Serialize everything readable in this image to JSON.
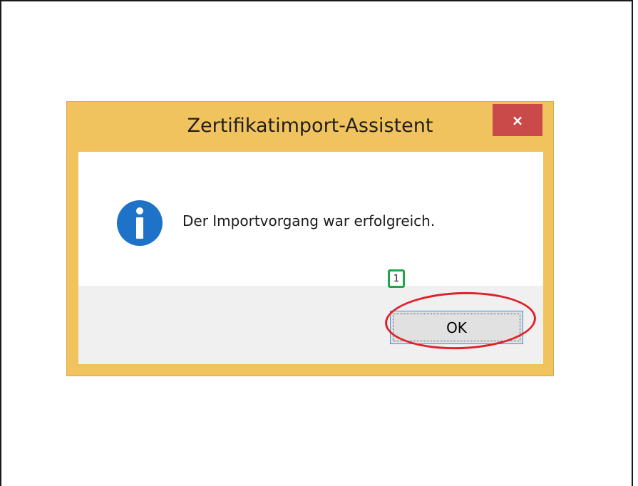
{
  "dialog": {
    "title": "Zertifikatimport-Assistent",
    "close_glyph": "×",
    "message": "Der Importvorgang war erfolgreich.",
    "icon": "info-icon",
    "ok_label": "OK"
  },
  "annotation": {
    "step_number": "1",
    "badge_color": "#1ea64a",
    "highlight_color": "#e0202a"
  },
  "colors": {
    "titlebar": "#f0c35f",
    "close_button": "#c94a48",
    "info_icon": "#1e73c8",
    "button_area": "#f0f0f0"
  }
}
